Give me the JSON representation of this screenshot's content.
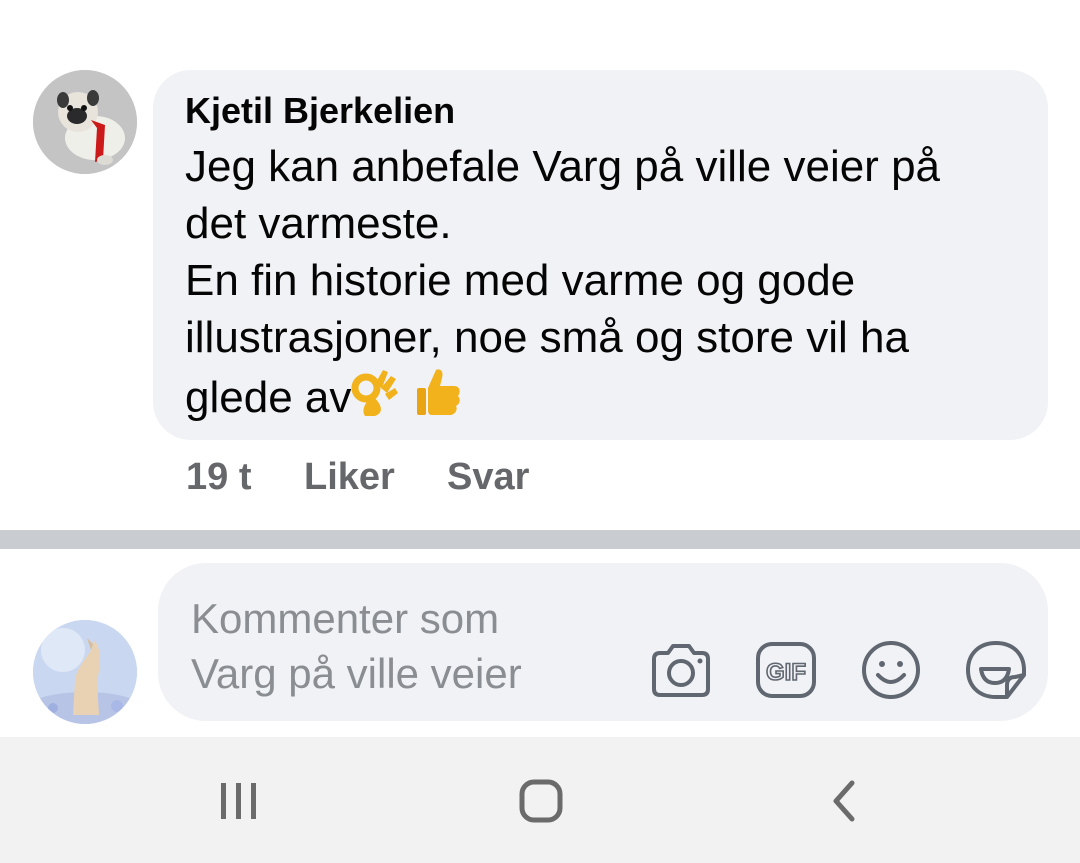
{
  "comment": {
    "author": "Kjetil Bjerkelien",
    "lines": [
      "Jeg kan anbefale Varg på ville veier på",
      "det varmeste.",
      "En fin historie med varme og gode",
      "illustrasjoner, noe små og store vil ha",
      "glede av"
    ],
    "emojis": [
      "ok-hand-emoji",
      "thumbs-up-emoji"
    ],
    "time": "19 t",
    "like_label": "Liker",
    "reply_label": "Svar"
  },
  "composer": {
    "placeholder_line1": "Kommenter som",
    "placeholder_line2": "Varg på ville veier",
    "tools": [
      "camera-icon",
      "gif-icon",
      "emoji-icon",
      "sticker-icon"
    ]
  },
  "navbar": {
    "buttons": [
      "recents-icon",
      "home-icon",
      "back-icon"
    ]
  },
  "colors": {
    "bubble_bg": "#f0f2f5",
    "text_primary": "#050505",
    "text_secondary": "#65676b",
    "placeholder": "#8a8d91",
    "divider": "#c9ccd1",
    "emoji_yellow": "#f7b928"
  }
}
